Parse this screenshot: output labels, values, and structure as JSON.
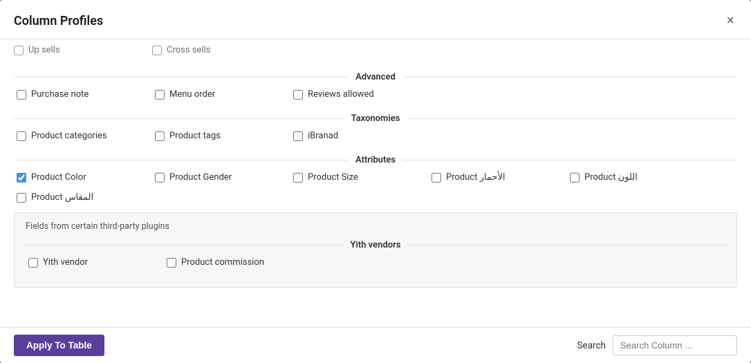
{
  "modal": {
    "title": "Column Profiles",
    "close_label": "×"
  },
  "top_partial": {
    "items": [
      {
        "label": "Up sells",
        "checked": false
      },
      {
        "label": "Cross sells",
        "checked": false
      }
    ]
  },
  "sections": [
    {
      "id": "advanced",
      "title": "Advanced",
      "items": [
        {
          "label": "Purchase note",
          "checked": false
        },
        {
          "label": "Menu order",
          "checked": false
        },
        {
          "label": "Reviews allowed",
          "checked": false
        }
      ]
    },
    {
      "id": "taxonomies",
      "title": "Taxonomies",
      "items": [
        {
          "label": "Product categories",
          "checked": false
        },
        {
          "label": "Product tags",
          "checked": false
        },
        {
          "label": "iBranad",
          "checked": false
        }
      ]
    },
    {
      "id": "attributes",
      "title": "Attributes",
      "items": [
        {
          "label": "Product Color",
          "checked": true
        },
        {
          "label": "Product Gender",
          "checked": false
        },
        {
          "label": "Product Size",
          "checked": false
        },
        {
          "label": "Product الأحمار",
          "checked": false
        },
        {
          "label": "Product اللون",
          "checked": false
        },
        {
          "label": "Product المقاس",
          "checked": false
        }
      ]
    }
  ],
  "third_party": {
    "title": "Fields from certain third-party plugins",
    "sub_sections": [
      {
        "title": "Yith vendors",
        "items": [
          {
            "label": "Yith vendor",
            "checked": false
          },
          {
            "label": "Product commission",
            "checked": false
          }
        ]
      }
    ]
  },
  "footer": {
    "apply_label": "Apply To Table",
    "search_label": "Search",
    "search_placeholder": "Search Column ..."
  }
}
